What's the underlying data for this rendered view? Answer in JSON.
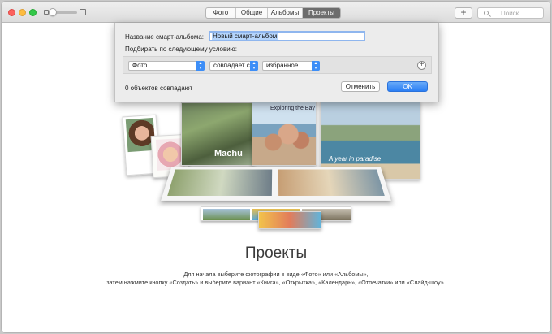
{
  "toolbar": {
    "tabs": [
      {
        "label": "Фото",
        "active": false
      },
      {
        "label": "Общие",
        "active": false
      },
      {
        "label": "Альбомы",
        "active": false
      },
      {
        "label": "Проекты",
        "active": true
      }
    ],
    "add_label": "+",
    "search_placeholder": "Поиск"
  },
  "sheet": {
    "name_label": "Название смарт-альбома:",
    "name_value": "Новый смарт-альбом",
    "condition_label": "Подбирать по следующему условию:",
    "rule": {
      "field": "Фото",
      "operator": "совпадает с",
      "value": "избранное"
    },
    "add_rule_label": "+",
    "match_count": "0 объектов совпадают",
    "cancel_label": "Отменить",
    "ok_label": "OK"
  },
  "illustration": {
    "machu_text": "Machu",
    "bay_title": "Exploring the Bay",
    "paradise_text": "A year in paradise"
  },
  "content": {
    "title": "Проекты",
    "line1": "Для начала выберите фотографии в виде «Фото» или «Альбомы»,",
    "line2": "затем нажмите кнопку «Создать» и выберите вариант «Книга», «Открытка», «Календарь», «Отпечатки» или «Слайд-шоу»."
  },
  "colors": {
    "accent": "#2b7ff5",
    "active_tab": "#6d6d6d",
    "selection": "#b4d4fb"
  }
}
